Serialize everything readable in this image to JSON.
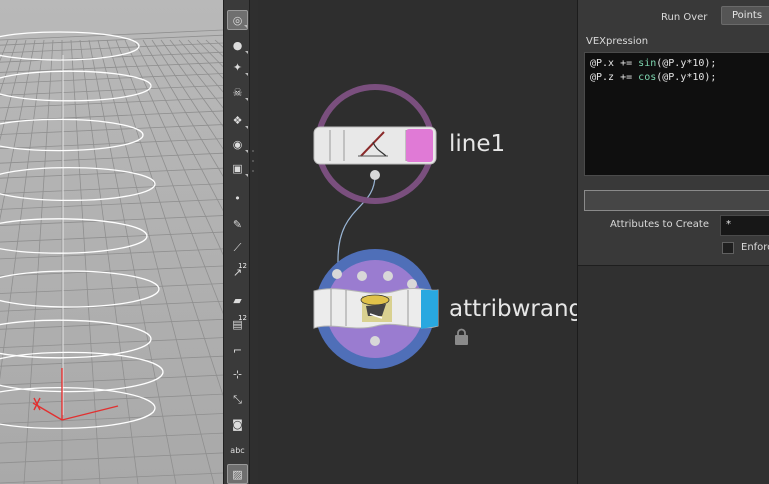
{
  "network": {
    "nodes": [
      {
        "id": "line1",
        "label": "line1"
      },
      {
        "id": "attribwrangle",
        "label": "attribwrang"
      }
    ]
  },
  "toolbar": {
    "tools": [
      {
        "icon": "select-icon",
        "text": ""
      },
      {
        "icon": "light-icon",
        "text": ""
      },
      {
        "icon": "light-add-icon",
        "text": ""
      },
      {
        "icon": "skull-icon",
        "text": ""
      },
      {
        "icon": "transform-icon",
        "text": ""
      },
      {
        "icon": "camera-eye-icon",
        "text": ""
      },
      {
        "icon": "camera-icon",
        "text": ""
      },
      {
        "icon": "point-icon",
        "text": ""
      },
      {
        "icon": "brush-icon",
        "text": ""
      },
      {
        "icon": "pipette-icon",
        "text": ""
      },
      {
        "icon": "number-icon",
        "text": "12"
      },
      {
        "icon": "eraser-icon",
        "text": ""
      },
      {
        "icon": "stack-number-icon",
        "text": "12"
      },
      {
        "icon": "corner-icon",
        "text": ""
      },
      {
        "icon": "snap-icon",
        "text": ""
      },
      {
        "icon": "axis-icon",
        "text": ""
      },
      {
        "icon": "record-icon",
        "text": ""
      },
      {
        "icon": "text-icon",
        "text": "abc"
      },
      {
        "icon": "image-icon",
        "text": ""
      }
    ]
  },
  "params": {
    "run_over_label": "Run Over",
    "run_over_value": "Points",
    "vex_label": "VEXpression",
    "vex_lines": [
      {
        "pre": "@P.x += ",
        "fn": "sin",
        "post": "(@P.y*10);"
      },
      {
        "pre": "@P.z += ",
        "fn": "cos",
        "post": "(@P.y*10);"
      }
    ],
    "attributes_label": "Attributes to Create",
    "attributes_value": "*",
    "enforce_label": "Enforc"
  },
  "colors": {
    "line_node_flag": "#e07ad6",
    "wrangle_flag": "#29a8e0",
    "line_ring": "#7a4f7e",
    "wrangle_ring": "#4f6fb8",
    "wrangle_inner": "#9a7cd0"
  }
}
